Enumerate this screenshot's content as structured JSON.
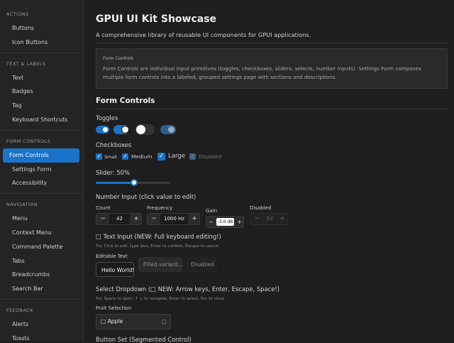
{
  "sidebar": {
    "sections": [
      {
        "title": "ACTIONS",
        "items": [
          "Buttons",
          "Icon Buttons"
        ]
      },
      {
        "title": "TEXT & LABELS",
        "items": [
          "Text",
          "Badges",
          "Tag",
          "Keyboard Shortcuts"
        ]
      },
      {
        "title": "FORM CONTROLS",
        "items": [
          "Form Controls",
          "Settings Form",
          "Accessibility"
        ]
      },
      {
        "title": "NAVIGATION",
        "items": [
          "Menu",
          "Context Menu",
          "Command Palette",
          "Tabs",
          "Breadcrumbs",
          "Search Bar"
        ]
      },
      {
        "title": "FEEDBACK",
        "items": [
          "Alerts",
          "Toasts"
        ]
      }
    ],
    "active_item": "Form Controls"
  },
  "header": {
    "title": "GPUI UI Kit Showcase",
    "description": "A comprehensive library of reusable UI components for GPUI applications."
  },
  "info": {
    "title": "Form Controls",
    "body": "Form Controls are individual input primitives (toggles, checkboxes, sliders, selects, number inputs). Settings Form composes multiple form controls into a labeled, grouped settings page with sections and descriptions."
  },
  "section_title": "Form Controls",
  "toggles": {
    "label": "Toggles",
    "states": [
      {
        "on": true,
        "size": "small"
      },
      {
        "on": true,
        "size": "medium"
      },
      {
        "on": false,
        "size": "large"
      },
      {
        "on": true,
        "size": "medium",
        "disabled": true
      }
    ]
  },
  "checkboxes": {
    "label": "Checkboxes",
    "items": [
      {
        "label": "Small",
        "checked": true
      },
      {
        "label": "Medium",
        "checked": true
      },
      {
        "label": "Large",
        "checked": true
      },
      {
        "label": "Disabled",
        "checked": true,
        "disabled": true
      }
    ]
  },
  "slider": {
    "label": "Slider: 50%",
    "value": 0.5
  },
  "number_input": {
    "label": "Number Input (click value to edit)",
    "fields": [
      {
        "label": "Count",
        "value": "42"
      },
      {
        "label": "Frequency",
        "value": "1000 Hz"
      },
      {
        "label": "Gain",
        "value": "-3.0 dB"
      },
      {
        "label": "Disabled",
        "value": "50"
      }
    ],
    "minus": "−",
    "plus": "+"
  },
  "text_input": {
    "label": "□ Text Input (NEW: Full keyboard editing!)",
    "hint": "Try: Click to edit, type text, Enter to confirm, Escape to cancel",
    "field_label": "Editable Text",
    "values": [
      "Hello World!",
      "Filled variant...",
      "Disabled"
    ]
  },
  "select": {
    "label": "Select Dropdown (□ NEW: Arrow keys, Enter, Escape, Space!)",
    "hint": "Try: Space to open, ↑ ↓ to navigate, Enter to select, Esc to close",
    "field_label": "Fruit Selection",
    "value": "□ Apple",
    "arrow": "□"
  },
  "next_section_partial": "Button Set (Segmented Control)",
  "colors": {
    "accent": "#1a73c8",
    "bg": "#1e1e1e",
    "sidebar": "#242424"
  }
}
